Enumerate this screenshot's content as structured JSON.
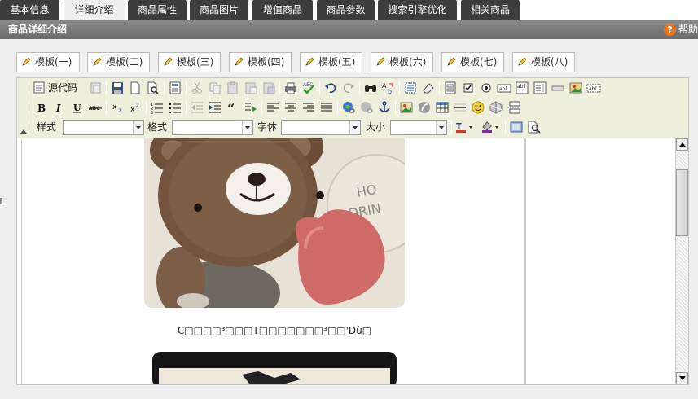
{
  "tabs": [
    {
      "label": "基本信息",
      "active": false
    },
    {
      "label": "详细介绍",
      "active": true
    },
    {
      "label": "商品属性",
      "active": false
    },
    {
      "label": "商品图片",
      "active": false
    },
    {
      "label": "增值商品",
      "active": false
    },
    {
      "label": "商品参数",
      "active": false
    },
    {
      "label": "搜索引擎优化",
      "active": false
    },
    {
      "label": "相关商品",
      "active": false
    }
  ],
  "panel": {
    "title": "商品详细介绍",
    "help_label": "帮助",
    "help_icon": "?"
  },
  "templates": [
    "模板(一)",
    "模板(二)",
    "模板(三)",
    "模板(四)",
    "模板(五)",
    "模板(六)",
    "模板(七)",
    "模板(八)"
  ],
  "toolbar": {
    "source_label": "源代码",
    "style_label": "样式",
    "format_label": "格式",
    "font_label": "字体",
    "size_label": "大小",
    "style_value": "",
    "format_value": "",
    "font_value": "",
    "size_value": ""
  },
  "document": {
    "caption": "C□□□□³□□□T□□□□□□□³□□'Dù□"
  },
  "colors": {
    "tab_bg": "#3d3d3d",
    "tab_active_bg": "#efefef",
    "header_bg": "#777777",
    "toolbar_bg": "#efefde",
    "help_icon": "#e8741c"
  }
}
